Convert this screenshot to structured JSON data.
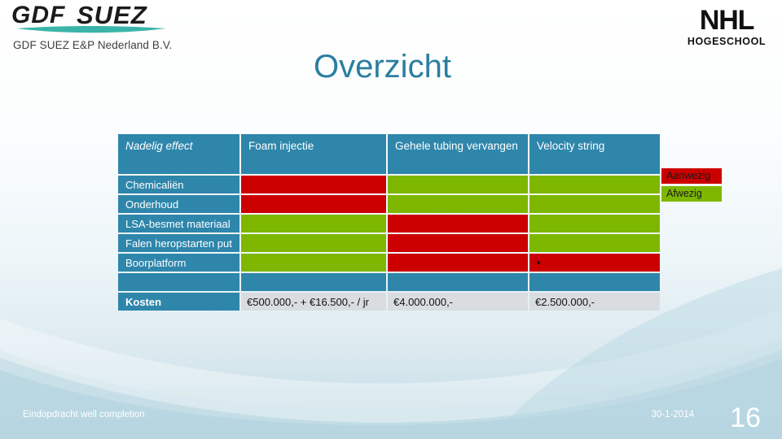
{
  "branding": {
    "gdf_logo_alt": "GDF SUEZ",
    "gdf_subtitle": "GDF SUEZ E&P Nederland B.V.",
    "nhl_main": "NHL",
    "nhl_sub": "HOGESCHOOL"
  },
  "slide": {
    "title": "Overzicht"
  },
  "table": {
    "headers": [
      "Nadelig effect",
      "Foam injectie",
      "Gehele tubing vervangen",
      "Velocity string"
    ],
    "rows": [
      {
        "label": "Chemicaliën",
        "states": [
          "red",
          "green",
          "green"
        ]
      },
      {
        "label": "Onderhoud",
        "states": [
          "red",
          "green",
          "green"
        ]
      },
      {
        "label": "LSA-besmet materiaal",
        "states": [
          "green",
          "red",
          "green"
        ]
      },
      {
        "label": "Falen heropstarten put",
        "states": [
          "green",
          "red",
          "green"
        ]
      },
      {
        "label": "Boorplatform",
        "states": [
          "green",
          "red",
          "red"
        ]
      }
    ],
    "marker_row": 4,
    "marker_col": 2,
    "spacer_row": true,
    "cost_row": {
      "label": "Kosten",
      "values": [
        "€500.000,- + €16.500,- / jr",
        "€4.000.000,-",
        "€2.500.000,-"
      ]
    }
  },
  "legend": {
    "items": [
      {
        "label": "Aanwezig",
        "state": "red"
      },
      {
        "label": "Afwezig",
        "state": "green"
      }
    ]
  },
  "footer": {
    "left": "Eindopdracht well completion",
    "date": "30-1-2014",
    "page_number": "16"
  },
  "colors": {
    "red": "#cc0000",
    "green": "#7db700",
    "blue": "#2e86ab",
    "title": "#2b7ea1",
    "cost_bg": "#d9dde0"
  }
}
